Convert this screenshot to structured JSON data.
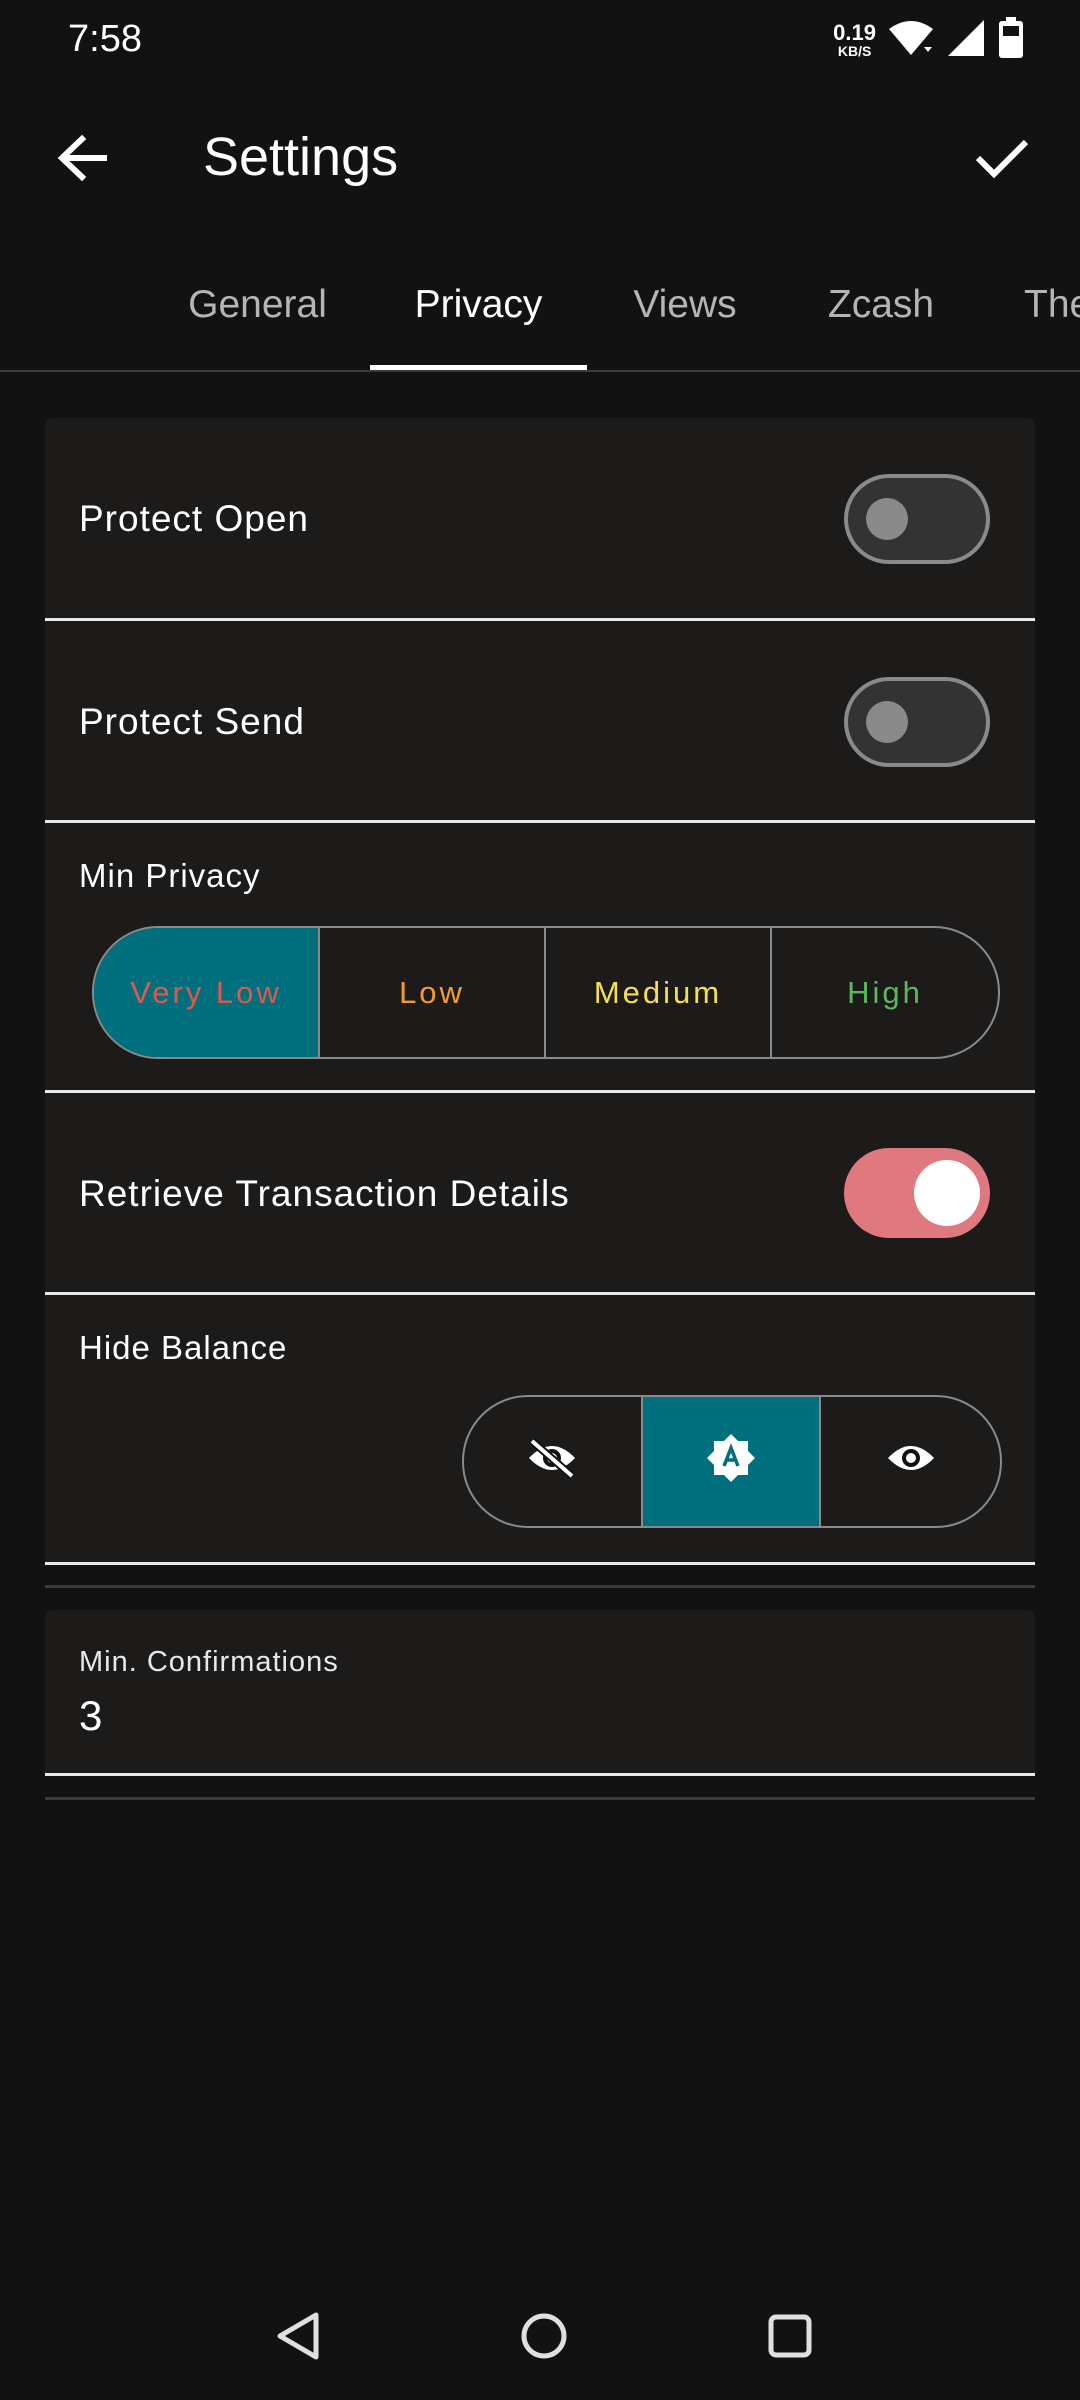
{
  "status_bar": {
    "time": "7:58",
    "net_speed_value": "0.19",
    "net_speed_unit": "KB/S"
  },
  "app_bar": {
    "title": "Settings",
    "back_icon": "arrow-back-icon",
    "confirm_icon": "check-icon"
  },
  "tabs": [
    {
      "label": "General",
      "active": false
    },
    {
      "label": "Privacy",
      "active": true
    },
    {
      "label": "Views",
      "active": false
    },
    {
      "label": "Zcash",
      "active": false
    },
    {
      "label": "The",
      "active": false
    }
  ],
  "settings": {
    "protect_open": {
      "label": "Protect Open",
      "enabled": false
    },
    "protect_send": {
      "label": "Protect Send",
      "enabled": false
    },
    "min_privacy": {
      "label": "Min Privacy",
      "options": [
        {
          "label": "Very Low",
          "color": "#e0584a",
          "selected": true
        },
        {
          "label": "Low",
          "color": "#f39a35",
          "selected": false
        },
        {
          "label": "Medium",
          "color": "#f4e04d",
          "selected": false
        },
        {
          "label": "High",
          "color": "#5cb85c",
          "selected": false
        }
      ]
    },
    "retrieve_tx_details": {
      "label": "Retrieve Transaction Details",
      "enabled": true
    },
    "hide_balance": {
      "label": "Hide Balance",
      "options": [
        {
          "icon": "eye-off-icon",
          "selected": false
        },
        {
          "icon": "brightness-auto-icon",
          "selected": true
        },
        {
          "icon": "eye-icon",
          "selected": false
        }
      ]
    },
    "min_confirmations": {
      "label": "Min. Confirmations",
      "value": "3"
    }
  },
  "colors": {
    "background": "#121212",
    "card": "#1d1a1a",
    "selected_segment": "#00707f",
    "switch_on": "#e0787f"
  },
  "nav_bar": {
    "back_icon": "nav-back-triangle-icon",
    "home_icon": "nav-home-circle-icon",
    "recents_icon": "nav-recents-square-icon"
  }
}
